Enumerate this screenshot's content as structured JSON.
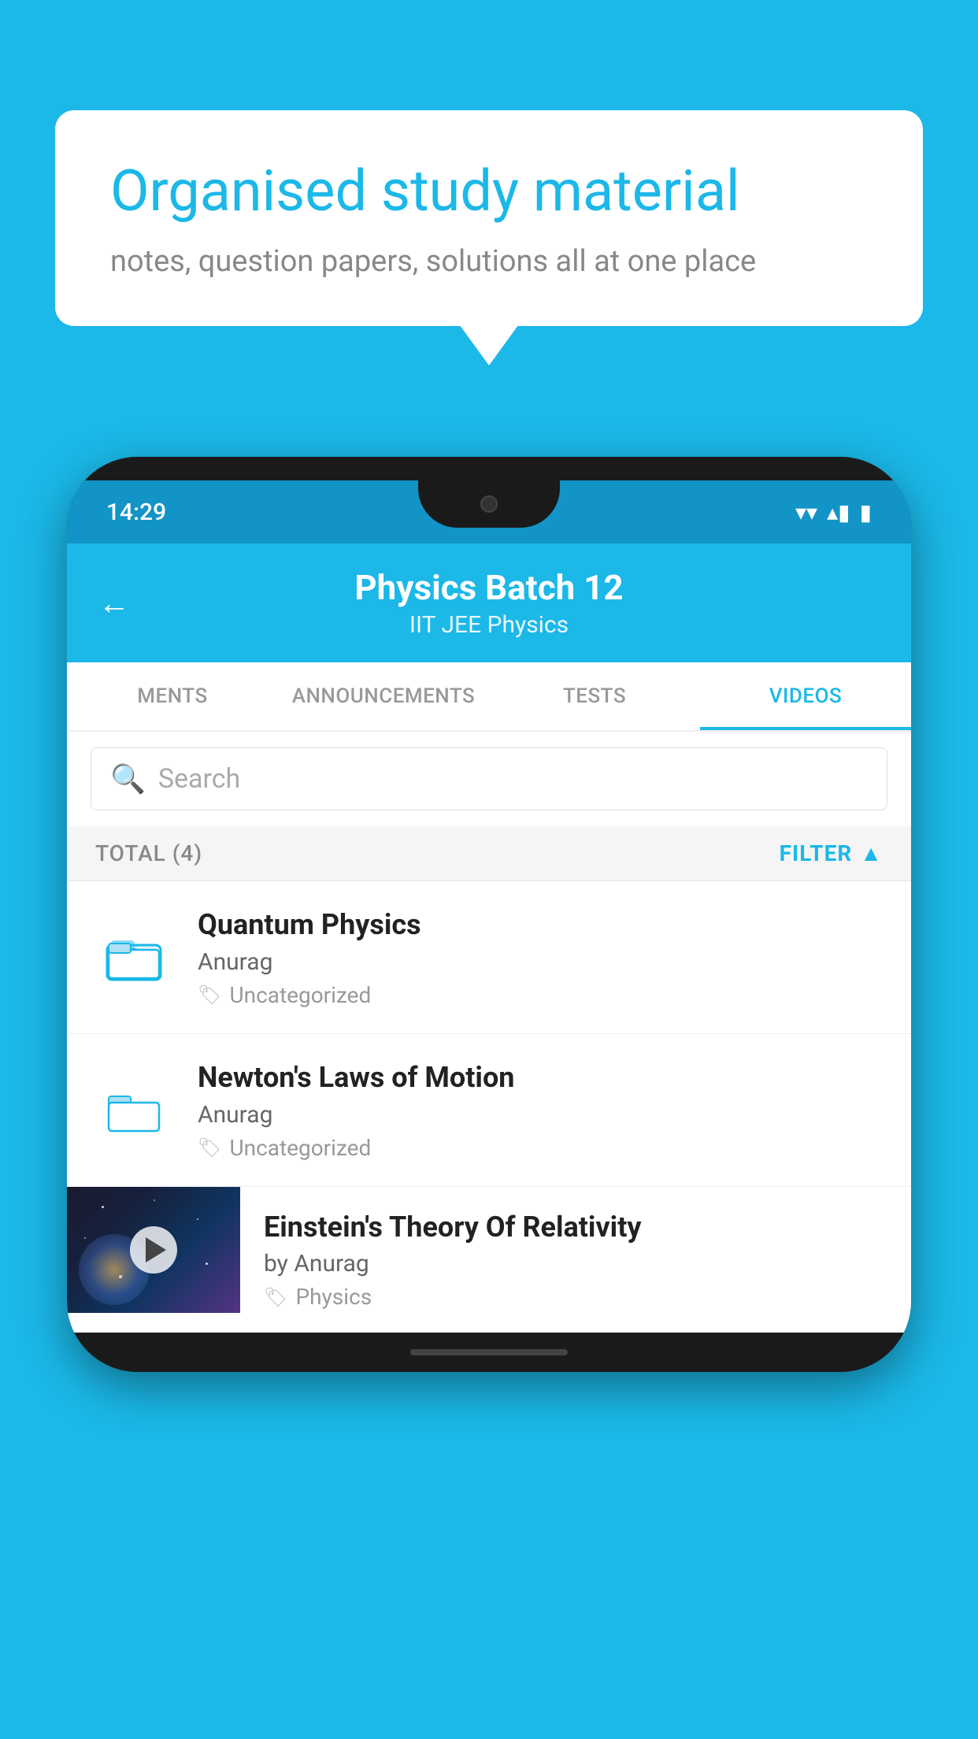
{
  "background_color": "#1bb8e8",
  "speech_bubble": {
    "title": "Organised study material",
    "subtitle": "notes, question papers, solutions all at one place"
  },
  "phone": {
    "status_bar": {
      "time": "14:29",
      "wifi": "▾",
      "signal": "▴",
      "battery": "▮"
    },
    "header": {
      "back_label": "←",
      "title": "Physics Batch 12",
      "subtitle": "IIT JEE   Physics"
    },
    "tabs": [
      {
        "label": "MENTS",
        "active": false
      },
      {
        "label": "ANNOUNCEMENTS",
        "active": false
      },
      {
        "label": "TESTS",
        "active": false
      },
      {
        "label": "VIDEOS",
        "active": true
      }
    ],
    "search": {
      "placeholder": "Search"
    },
    "filter_row": {
      "total_label": "TOTAL (4)",
      "filter_label": "FILTER"
    },
    "videos": [
      {
        "title": "Quantum Physics",
        "author": "Anurag",
        "tag": "Uncategorized",
        "has_thumb": false
      },
      {
        "title": "Newton's Laws of Motion",
        "author": "Anurag",
        "tag": "Uncategorized",
        "has_thumb": false
      },
      {
        "title": "Einstein's Theory Of Relativity",
        "author": "by Anurag",
        "tag": "Physics",
        "has_thumb": true
      }
    ]
  }
}
